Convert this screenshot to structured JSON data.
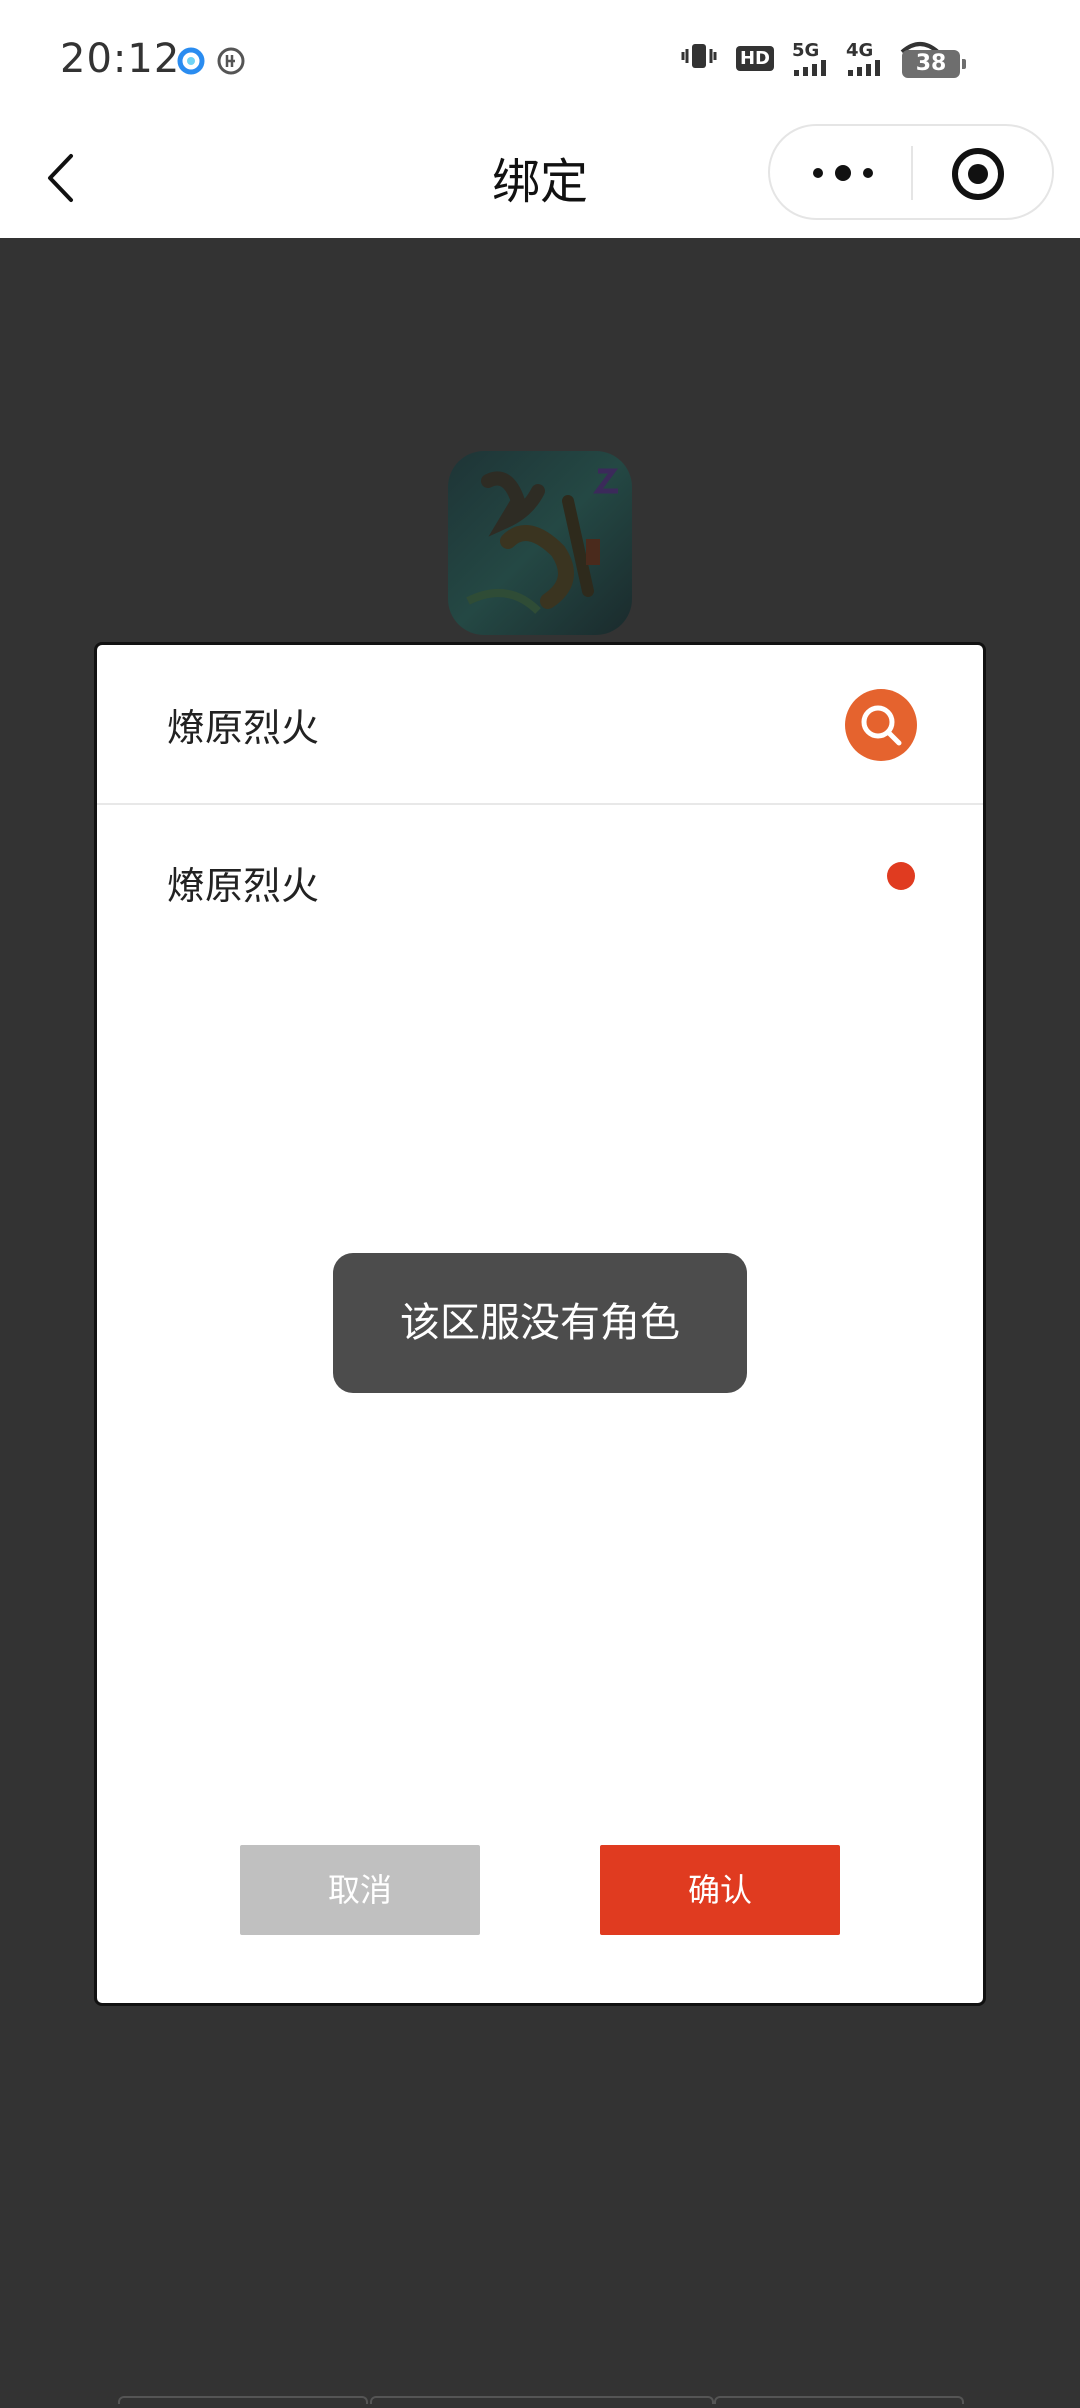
{
  "status_bar": {
    "time": "20:12",
    "hd_label": "HD",
    "signal_5g": "5G",
    "signal_4g": "4G",
    "battery": "38"
  },
  "nav": {
    "title": "绑定"
  },
  "modal": {
    "server_name": "燎原烈火",
    "list_items": [
      {
        "label": "燎原烈火"
      }
    ],
    "cancel_label": "取消",
    "confirm_label": "确认"
  },
  "toast": {
    "message": "该区服没有角色"
  },
  "colors": {
    "accent": "#e03b20",
    "search": "#e5632e",
    "overlay": "#333333"
  }
}
